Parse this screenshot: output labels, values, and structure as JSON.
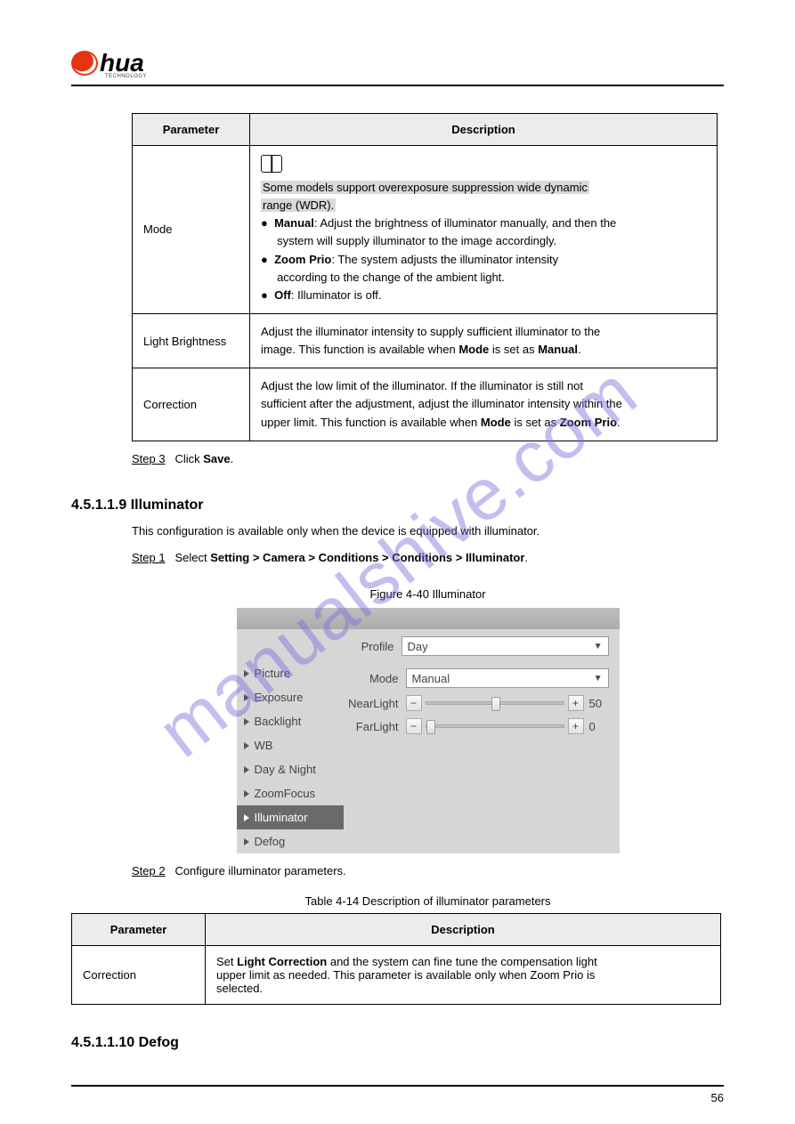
{
  "logo": {
    "brand": "hua",
    "tech": "TECHNOLOGY"
  },
  "table1": {
    "h1": "Parameter",
    "h2": "Description",
    "r1": {
      "param": "Mode",
      "note_l1": "Some models support overexposure suppression wide dynamic",
      "note_l2": "range (WDR).",
      "b1_lead": "Manual",
      "b1_txt": ": Adjust the brightness of illuminator manually, and then the",
      "b1_l2": "system will supply illuminator to the image accordingly.",
      "b2_lead": "Zoom Prio",
      "b2_txt": ": The system adjusts the illuminator intensity",
      "b2_l2": "according to the change of the ambient light.",
      "b3_lead": "Off",
      "b3_txt": ": Illuminator is off."
    },
    "r2": {
      "param": "Light Brightness",
      "txt_l1": "Adjust the illuminator intensity to supply sufficient illuminator to the",
      "txt_l2": "image. This function is available when ",
      "txt_l2b": "Mode",
      "txt_l2c": " is set as ",
      "txt_l2d": "Manual",
      "txt_l2e": "."
    },
    "r3": {
      "param": "Correction",
      "txt_l1": "Adjust the low limit of the illuminator. If the illuminator is still not",
      "txt_l2": "sufficient after the adjustment, adjust the illuminator intensity within the",
      "txt_l3": "upper limit. This function is available when ",
      "txt_l3b": "Mode",
      "txt_l3c": " is set as ",
      "txt_l3d": "Zoom Prio",
      "txt_l3e": "."
    }
  },
  "steps": {
    "s3a": "Step 3",
    "s3b": "Click ",
    "s3c": "Save",
    "s3d": ".",
    "s1a": "Step 1",
    "s1b": "Select ",
    "s1c": "Setting > Camera > Conditions > Conditions > Illuminator",
    "s1d": "."
  },
  "section": {
    "num": "4.5.1.1.9",
    "title": "Illuminator",
    "desc": "This configuration is available only when the device is equipped with illuminator."
  },
  "fig": {
    "cap": "Figure 4-40 Illuminator"
  },
  "ui": {
    "profile_label": "Profile",
    "profile_value": "Day",
    "side": [
      "Picture",
      "Exposure",
      "Backlight",
      "WB",
      "Day & Night",
      "ZoomFocus",
      "Illuminator",
      "Defog"
    ],
    "mode_label": "Mode",
    "mode_value": "Manual",
    "near_label": "NearLight",
    "near_val": "50",
    "far_label": "FarLight",
    "far_val": "0",
    "minus": "−",
    "plus": "+"
  },
  "steps2": {
    "s2a": "Step 2",
    "s2b": "Configure illuminator parameters."
  },
  "table2_cap": "Table 4-14 Description of illuminator parameters",
  "table2": {
    "h1": "Parameter",
    "h2": "Description",
    "r1": {
      "param": "Correction",
      "l1_a": "Set ",
      "l1_b": "Light Correction",
      "l1_c": " and the system can fine tune the compensation light",
      "l2": "upper limit as needed. This parameter is available only when Zoom Prio is",
      "l3": "selected."
    }
  },
  "footer": {
    "sec": "4.5.1.1.10",
    "title": "Defog"
  },
  "page_num": "56",
  "watermark": "manualshive.com"
}
